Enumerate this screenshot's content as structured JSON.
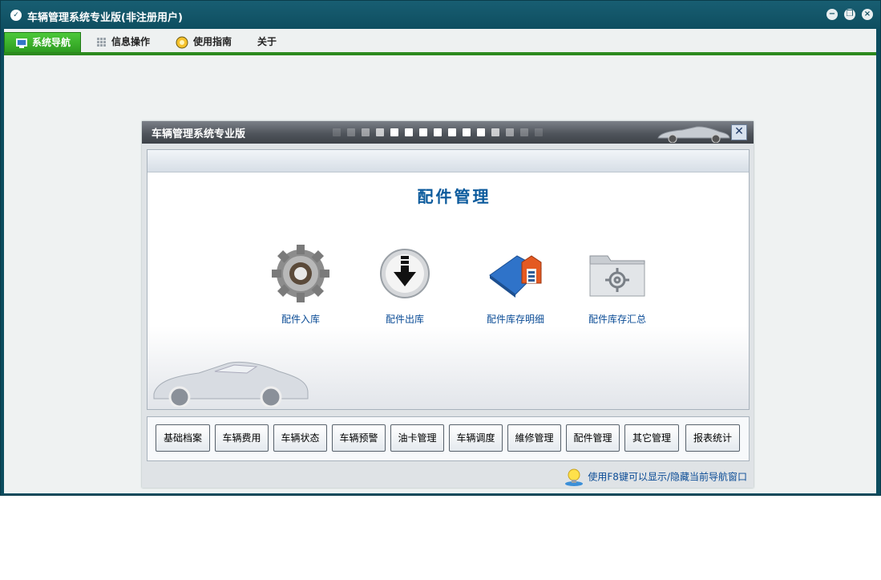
{
  "window": {
    "title": "车辆管理系统专业版(非注册用户)"
  },
  "menu": [
    {
      "label": "系统导航",
      "icon": "monitor-icon"
    },
    {
      "label": "信息操作",
      "icon": "grid-icon"
    },
    {
      "label": "使用指南",
      "icon": "bulb-icon"
    },
    {
      "label": "关于"
    }
  ],
  "dialog": {
    "title": "车辆管理系统专业版",
    "section_title": "配件管理",
    "features": [
      {
        "label": "配件入库",
        "icon": "gear-icon"
      },
      {
        "label": "配件出库",
        "icon": "download-arrow-icon"
      },
      {
        "label": "配件库存明细",
        "icon": "book-house-icon"
      },
      {
        "label": "配件库存汇总",
        "icon": "folder-gear-icon"
      }
    ],
    "nav_buttons": [
      "基础档案",
      "车辆费用",
      "车辆状态",
      "车辆预警",
      "油卡管理",
      "车辆调度",
      "維修管理",
      "配件管理",
      "其它管理",
      "报表统计"
    ],
    "hint": "使用F8键可以显示/隐藏当前导航窗口"
  },
  "colors": {
    "titlebar": "#0e4e60",
    "menu_active": "#3cb42c",
    "accent_text": "#0b5a9c"
  }
}
